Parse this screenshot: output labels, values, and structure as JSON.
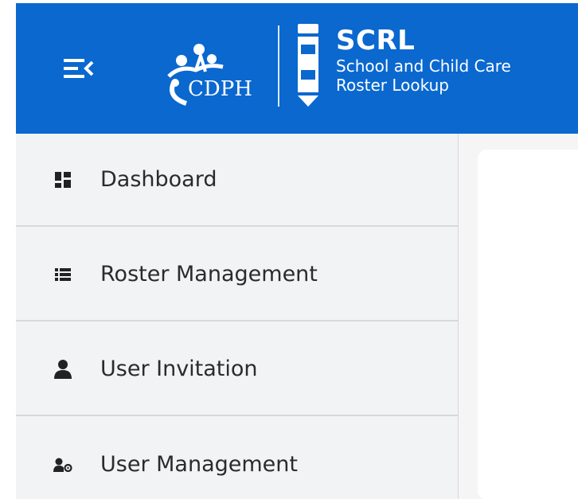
{
  "header": {
    "background_color": "#0a68cf",
    "org_logo_text": "CDPH",
    "app_title": "SCRL",
    "app_subtitle_line1": "School and Child Care",
    "app_subtitle_line2": "Roster Lookup",
    "menu_toggle_icon": "menu-collapse-icon"
  },
  "sidebar": {
    "items": [
      {
        "label": "Dashboard",
        "icon": "dashboard-icon"
      },
      {
        "label": "Roster Management",
        "icon": "list-icon"
      },
      {
        "label": "User Invitation",
        "icon": "person-icon"
      },
      {
        "label": "User Management",
        "icon": "user-gear-icon"
      }
    ]
  }
}
